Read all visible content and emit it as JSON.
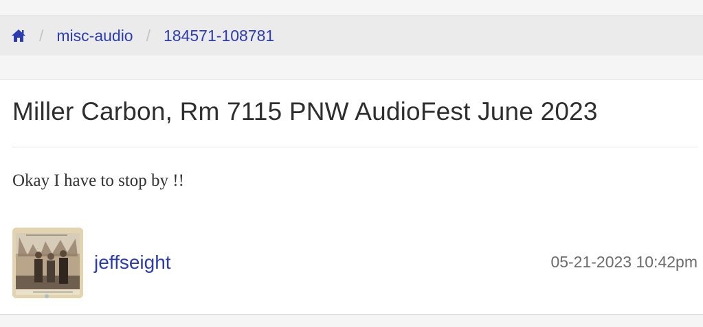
{
  "breadcrumb": {
    "home_icon": "home-icon",
    "separator": "/",
    "items": [
      "misc-audio",
      "184571-108781"
    ]
  },
  "post": {
    "title": "Miller Carbon, Rm 7115 PNW AudioFest June 2023",
    "body": "Okay I have to stop by !!",
    "author": "jeffseight",
    "timestamp": "05-21-2023 10:42pm"
  },
  "colors": {
    "link": "#2b3cb0",
    "title_text": "#2e2e2e",
    "muted_text": "#6b6b6b"
  }
}
